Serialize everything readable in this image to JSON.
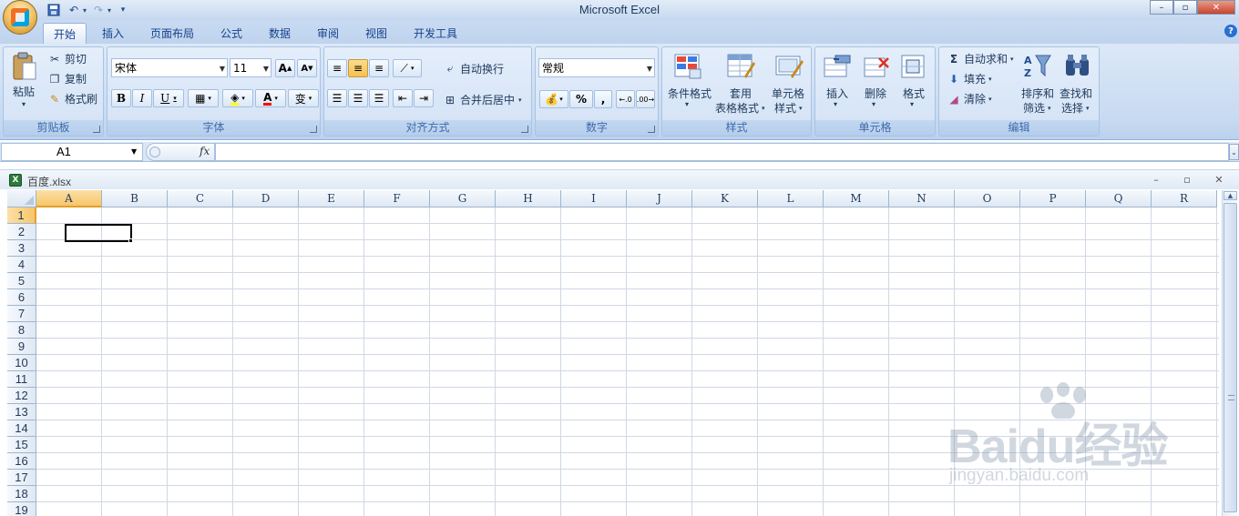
{
  "window": {
    "title": "Microsoft Excel"
  },
  "tabs": [
    {
      "label": "开始",
      "active": true
    },
    {
      "label": "插入"
    },
    {
      "label": "页面布局"
    },
    {
      "label": "公式"
    },
    {
      "label": "数据"
    },
    {
      "label": "审阅"
    },
    {
      "label": "视图"
    },
    {
      "label": "开发工具"
    }
  ],
  "ribbon": {
    "clipboard": {
      "label": "剪贴板",
      "paste": "粘贴",
      "cut": "剪切",
      "copy": "复制",
      "format_painter": "格式刷"
    },
    "font": {
      "label": "字体",
      "font_name": "宋体",
      "font_size": "11",
      "bold": "B",
      "italic": "I",
      "underline": "U",
      "grow": "A",
      "shrink": "A",
      "font_color": "A",
      "phonetic": "变"
    },
    "alignment": {
      "label": "对齐方式",
      "wrap_text": "自动换行",
      "merge_center": "合并后居中"
    },
    "number": {
      "label": "数字",
      "format": "常规",
      "percent": "%",
      "comma": ","
    },
    "styles": {
      "label": "样式",
      "conditional": "条件格式",
      "table_1": "套用",
      "table_2": "表格格式",
      "cell_style_1": "单元格",
      "cell_style_2": "样式"
    },
    "cells": {
      "label": "单元格",
      "insert": "插入",
      "delete": "删除",
      "format": "格式"
    },
    "editing": {
      "label": "编辑",
      "autosum": "自动求和",
      "fill": "填充",
      "clear": "清除",
      "sort_1": "排序和",
      "sort_2": "筛选",
      "find_1": "查找和",
      "find_2": "选择",
      "sigma": "Σ"
    }
  },
  "formula_bar": {
    "name_box": "A1",
    "fx": "fx",
    "formula": ""
  },
  "workbook": {
    "title": "百度.xlsx",
    "minimize": "–",
    "restore": "▫",
    "close": "✕"
  },
  "sheet": {
    "columns": [
      "A",
      "B",
      "C",
      "D",
      "E",
      "F",
      "G",
      "H",
      "I",
      "J",
      "K",
      "L",
      "M",
      "N",
      "O",
      "P",
      "Q",
      "R"
    ],
    "rows": [
      "1",
      "2",
      "3",
      "4",
      "5",
      "6",
      "7",
      "8",
      "9",
      "10",
      "11",
      "12",
      "13",
      "14",
      "15",
      "16",
      "17",
      "18",
      "19"
    ],
    "active_cell": "A1"
  },
  "watermark": {
    "text": "Baidu经验",
    "sub": "jingyan.baidu.com"
  },
  "colors": {
    "ribbon_bg": "#dce8f6",
    "selected_header": "#f7c669",
    "gridline": "#d0d7e5"
  }
}
